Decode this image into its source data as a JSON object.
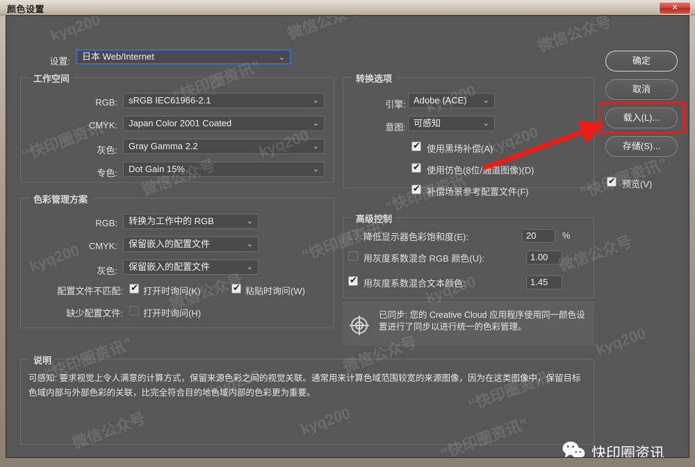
{
  "window": {
    "title": "颜色设置",
    "close_label": "✕"
  },
  "settings_row": {
    "label": "设置:",
    "value": "日本 Web/Internet",
    "chevron": "⌄"
  },
  "working_spaces": {
    "title": "工作空间",
    "rows": [
      {
        "label": "RGB:",
        "value": "sRGB IEC61966-2.1"
      },
      {
        "label": "CMYK:",
        "value": "Japan Color 2001 Coated"
      },
      {
        "label": "灰色:",
        "value": "Gray Gamma 2.2"
      },
      {
        "label": "专色:",
        "value": "Dot Gain 15%"
      }
    ]
  },
  "color_management_policies": {
    "title": "色彩管理方案",
    "rows": [
      {
        "label": "RGB:",
        "value": "转换为工作中的 RGB"
      },
      {
        "label": "CMYK:",
        "value": "保留嵌入的配置文件"
      },
      {
        "label": "灰色:",
        "value": "保留嵌入的配置文件"
      }
    ],
    "mismatch_label": "配置文件不匹配:",
    "mismatch_open": {
      "label": "打开时询问(K)",
      "checked": true
    },
    "mismatch_paste": {
      "label": "粘贴时询问(W)",
      "checked": true
    },
    "missing_label": "缺少配置文件:",
    "missing_open": {
      "label": "打开时询问(H)",
      "checked": false
    }
  },
  "conversion_options": {
    "title": "转换选项",
    "engine_label": "引擎:",
    "engine_value": "Adobe (ACE)",
    "intent_label": "意图:",
    "intent_value": "可感知",
    "checkboxes": [
      {
        "label": "使用黑场补偿(A)",
        "checked": true
      },
      {
        "label": "使用仿色(8位/通道图像)(D)",
        "checked": true
      },
      {
        "label": "补偿场景参考配置文件(F)",
        "checked": true
      }
    ]
  },
  "advanced_controls": {
    "title": "高级控制",
    "rows": [
      {
        "label": "降低显示器色彩饱和度(E):",
        "checked": false,
        "value": "20",
        "unit": "%"
      },
      {
        "label": "用灰度系数混合 RGB 颜色(U):",
        "checked": false,
        "value": "1.00",
        "unit": ""
      },
      {
        "label": "用灰度系数混合文本颜色:",
        "checked": true,
        "value": "1.45",
        "unit": ""
      }
    ]
  },
  "sync_notice": {
    "icon": "sync-target-icon",
    "text": "已同步: 您的 Creative Cloud 应用程序使用同一颜色设置进行了同步以进行统一的色彩管理。"
  },
  "description": {
    "title": "说明",
    "text": "可感知: 要求视觉上令人满意的计算方式，保留来源色彩之间的视觉关联。通常用来计算色域范围较宽的来源图像，因为在这类图像中，保留目标色域内部与外部色彩的关联，比完全符合目的地色域内部的色彩更为重要。"
  },
  "buttons": {
    "ok": "确定",
    "cancel": "取消",
    "load": "载入(L)...",
    "save": "存储(S)...",
    "preview": {
      "label": "预览(V)",
      "checked": true
    }
  },
  "annotation": {
    "highlight_target": "load-button",
    "arrow_color": "#ee1c15"
  },
  "branding": {
    "wechat_label": "快印圈资讯"
  },
  "watermarks": {
    "text_a": "kyq200",
    "text_b": "“快印圈资讯”",
    "text_c": "微信公众号"
  }
}
